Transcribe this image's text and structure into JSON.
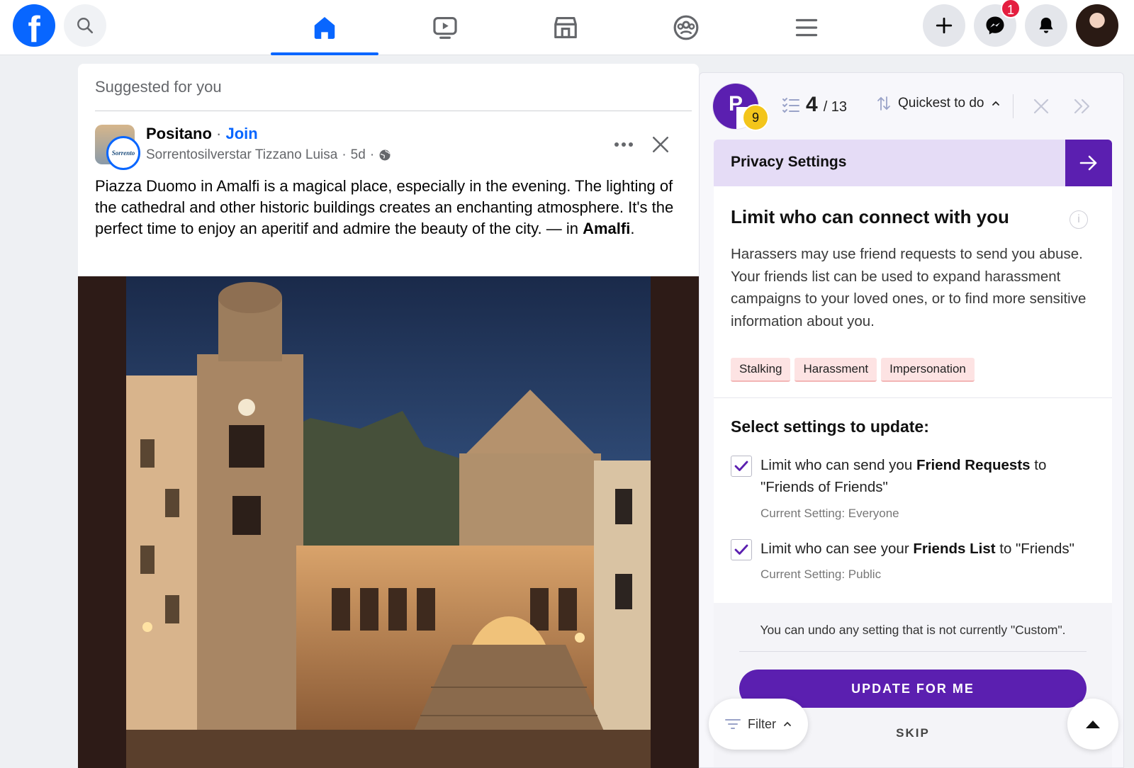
{
  "nav": {
    "logo_letter": "f",
    "notifications_count": "1",
    "tabs": [
      {
        "name": "home",
        "icon": "home-icon",
        "active": true
      },
      {
        "name": "watch",
        "icon": "video-icon",
        "active": false
      },
      {
        "name": "marketplace",
        "icon": "store-icon",
        "active": false
      },
      {
        "name": "groups",
        "icon": "groups-icon",
        "active": false
      },
      {
        "name": "menu",
        "icon": "menu-icon",
        "active": false
      }
    ],
    "accent": "#0866ff"
  },
  "feed": {
    "suggested_label": "Suggested for you",
    "group_name": "Positano",
    "join_label": "Join",
    "group_avatar_text": "Sorrento",
    "author": "Sorrentosilverstar Tizzano Luisa",
    "time": "5d",
    "post_text_main": "Piazza Duomo in Amalfi is a magical place, especially in the evening. The lighting of the cathedral and other historic buildings creates an enchanting atmosphere. It's the perfect time to enjoy an aperitif and admire the beauty of the city. — in ",
    "post_location": "Amalfi",
    "post_text_end": "."
  },
  "panel": {
    "logo_letter": "P",
    "logo_badge": "9",
    "progress_current": "4",
    "progress_total": "/ 13",
    "sort_label": "Quickest to do",
    "section_title": "Privacy Settings",
    "card_title": "Limit who can connect with you",
    "description": "Harassers may use friend requests to send you abuse. Your friends list can be used to expand harassment campaigns to your loved ones, or to find more sensitive information about you.",
    "tags": [
      "Stalking",
      "Harassment",
      "Impersonation"
    ],
    "select_title": "Select settings to update:",
    "options": [
      {
        "pre": "Limit who can send you ",
        "bold": "Friend Requests",
        "post": " to \"Friends of Friends\"",
        "current": "Current Setting: Everyone",
        "checked": true
      },
      {
        "pre": "Limit who can see your ",
        "bold": "Friends List",
        "post": " to \"Friends\"",
        "current": "Current Setting: Public",
        "checked": true
      }
    ],
    "undo_text": "You can undo any setting that is not currently \"Custom\".",
    "update_button": "UPDATE FOR ME",
    "skip_button": "SKIP",
    "filter_label": "Filter",
    "accent": "#5b1fb0"
  }
}
